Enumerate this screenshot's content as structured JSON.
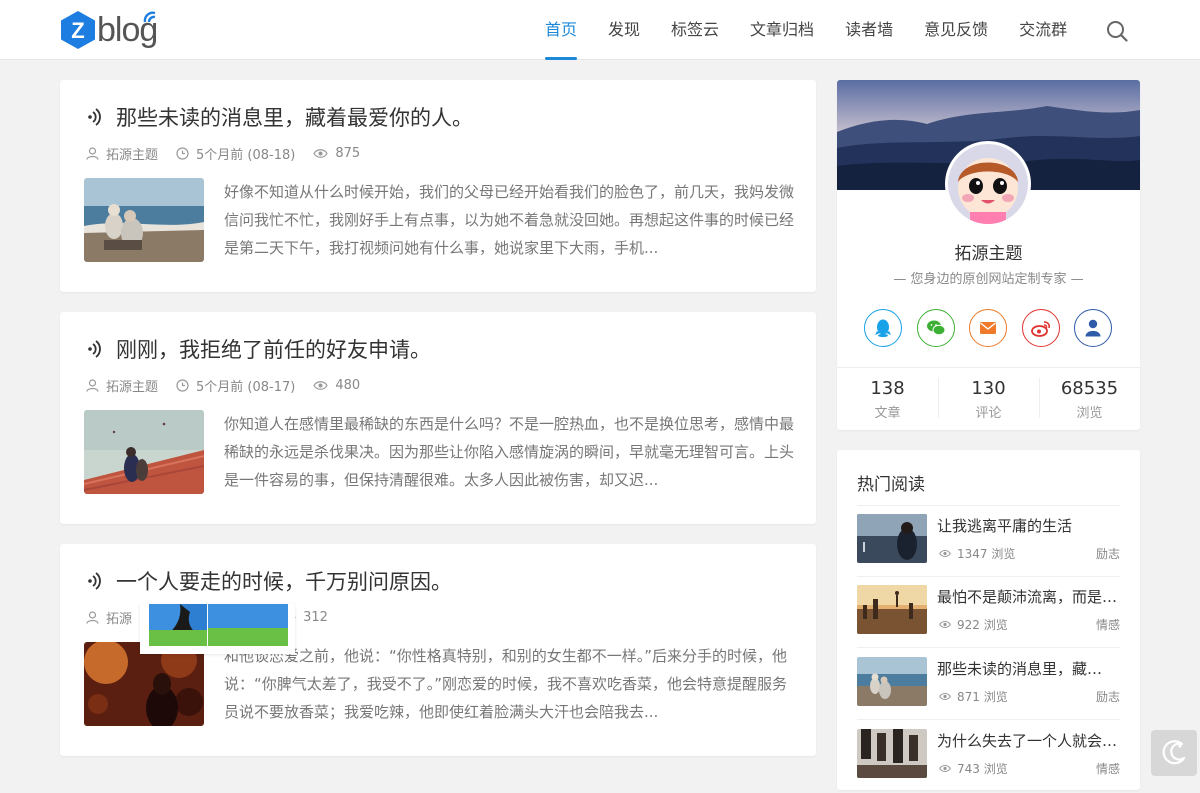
{
  "header": {
    "logo_text": "blog",
    "logo_letter": "Z",
    "nav": [
      "首页",
      "发现",
      "标签云",
      "文章归档",
      "读者墙",
      "意见反馈",
      "交流群"
    ],
    "active_index": 0,
    "accent": "#1e88d9"
  },
  "posts": [
    {
      "title": "那些未读的消息里，藏着最爱你的人。",
      "author": "拓源主题",
      "date": "5个月前 (08-18)",
      "views": "875",
      "excerpt": "好像不知道从什么时候开始，我们的父母已经开始看我们的脸色了，前几天，我妈发微信问我忙不忙，我刚好手上有点事，以为她不着急就没回她。再想起这件事的时候已经是第二天下午，我打视频问她有什么事，她说家里下大雨，手机..."
    },
    {
      "title": "刚刚，我拒绝了前任的好友申请。",
      "author": "拓源主题",
      "date": "5个月前 (08-17)",
      "views": "480",
      "excerpt": "你知道人在感情里最稀缺的东西是什么吗？不是一腔热血，也不是换位思考，感情中最稀缺的永远是杀伐果决。因为那些让你陷入感情旋涡的瞬间，早就毫无理智可言。上头是一件容易的事，但保持清醒很难。太多人因此被伤害，却又迟..."
    },
    {
      "title": "一个人要走的时候，千万别问原因。",
      "author": "拓源",
      "date": ")",
      "views": "312",
      "excerpt": "和他谈恋爱之前，他说：“你性格真特别，和别的女生都不一样。”后来分手的时候，他说：“你脾气太差了，我受不了。”刚恋爱的时候，我不喜欢吃香菜，他会特意提醒服务员说不要放香菜；我爱吃辣，他即使红着脸满头大汗也会陪我去..."
    }
  ],
  "profile": {
    "name": "拓源主题",
    "tagline": "— 您身边的原创网站定制专家 —",
    "socials": [
      "qq-icon",
      "wechat-icon",
      "email-icon",
      "weibo-icon",
      "user-icon"
    ],
    "stats": [
      {
        "num": "138",
        "label": "文章"
      },
      {
        "num": "130",
        "label": "评论"
      },
      {
        "num": "68535",
        "label": "浏览"
      }
    ]
  },
  "hot": {
    "title": "热门阅读",
    "items": [
      {
        "title": "让我逃离平庸的生活",
        "views": "1347 浏览",
        "cat": "励志"
      },
      {
        "title": "最怕不是颠沛流离，而是…",
        "views": "922 浏览",
        "cat": "情感"
      },
      {
        "title": "那些未读的消息里，藏着最爱你的人。",
        "views": "871 浏览",
        "cat": "励志"
      },
      {
        "title": "为什么失去了一个人就会…",
        "views": "743 浏览",
        "cat": "情感"
      }
    ]
  }
}
